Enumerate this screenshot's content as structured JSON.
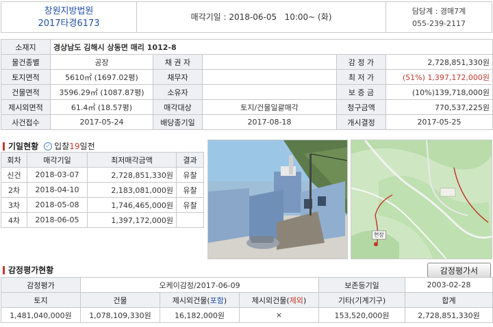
{
  "header": {
    "court": "창원지방법원",
    "case_no": "2017타경6173",
    "auction_date": "매각기일 : 2018-06-05   10:00~ (화)",
    "dept": "담당계 : 경매7계",
    "phone": "055-239-2117"
  },
  "info": {
    "address_label": "소재지",
    "address": "경상남도 김해시 상동면 매리 1012-8",
    "rows": [
      {
        "l1": "물건종별",
        "v1": "공장",
        "l2": "채 권 자",
        "v2": "",
        "l3": "감 정 가",
        "v3": "2,728,851,330원"
      },
      {
        "l1": "토지면적",
        "v1": "5610㎡ (1697.02평)",
        "l2": "채무자",
        "v2": "",
        "l3": "최 저 가",
        "v3": "(51%) 1,397,172,000원"
      },
      {
        "l1": "건물면적",
        "v1": "3596.29㎡ (1087.87평)",
        "l2": "소유자",
        "v2": "",
        "l3": "보 증 금",
        "v3": "(10%)139,718,000원"
      },
      {
        "l1": "제시외면적",
        "v1": "61.4㎡ (18.57평)",
        "l2": "매각대상",
        "v2": "토지/건물일괄매각",
        "l3": "청구금액",
        "v3": "770,537,225원"
      },
      {
        "l1": "사건접수",
        "v1": "2017-05-24",
        "l2": "배당종기일",
        "v2": "2017-08-18",
        "l3": "개시결정",
        "v3": "2017-05-25"
      }
    ]
  },
  "history": {
    "title": "기일현황",
    "bid_prefix": "입찰",
    "bid_days": "19",
    "bid_suffix": "일전",
    "icon_glyph": "✓",
    "headers": [
      "회차",
      "매각기일",
      "최저매각금액",
      "결과"
    ],
    "rows": [
      {
        "round": "신건",
        "date": "2018-03-07",
        "price": "2,728,851,330원",
        "result": "유찰"
      },
      {
        "round": "2차",
        "date": "2018-04-10",
        "price": "2,183,081,000원",
        "result": "유찰"
      },
      {
        "round": "3차",
        "date": "2018-05-08",
        "price": "1,746,465,000원",
        "result": "유찰"
      },
      {
        "round": "4차",
        "date": "2018-06-05",
        "price": "1,397,172,000원",
        "result": ""
      }
    ]
  },
  "appraisal": {
    "title": "감정평가현황",
    "button": "감정평가서",
    "row1": {
      "l1": "감정평가",
      "v1": "오케이감정/2017-06-09",
      "l2": "보존등기일",
      "v2": "2003-02-28"
    },
    "headers": {
      "land": "토지",
      "building": "건물",
      "extra_inc_prefix": "제시외건물(",
      "extra_inc_word": "포함",
      "extra_exc_prefix": "제시외건물(",
      "extra_exc_word": "제외",
      "close_paren": ")",
      "other": "기타(기계기구)",
      "total": "합계"
    },
    "values": {
      "land": "1,481,040,000원",
      "building": "1,078,109,330원",
      "extra_inc": "16,182,000원",
      "extra_exc": "×",
      "other": "153,520,000원",
      "total": "2,728,851,330원"
    }
  },
  "map_label": "현장",
  "colors": {
    "court_blue": "#1f4fa8",
    "price_red": "#c0392b",
    "label_bg": "#eef0f4"
  }
}
